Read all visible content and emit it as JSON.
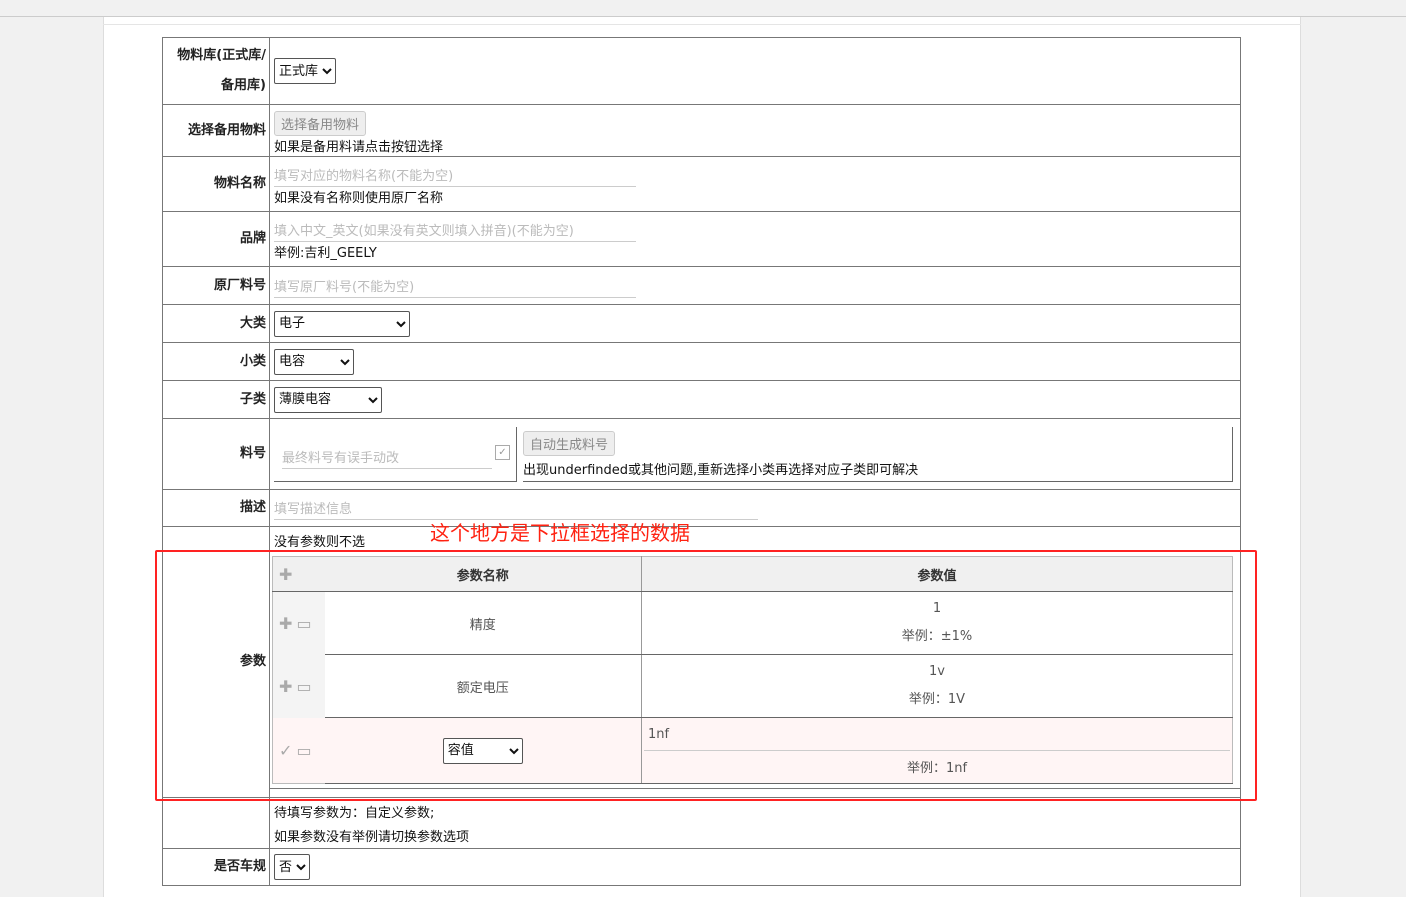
{
  "library": {
    "label": "物料库(正式库/备用库)",
    "label_line1": "物料库(正式库/",
    "label_line2": "备用库)",
    "value": "正式库"
  },
  "spare": {
    "label": "选择备用物料",
    "button": "选择备用物料",
    "note": "如果是备用料请点击按钮选择"
  },
  "name": {
    "label": "物料名称",
    "placeholder": "填写对应的物料名称(不能为空)",
    "note": "如果没有名称则使用原厂名称"
  },
  "brand": {
    "label": "品牌",
    "placeholder": "填入中文_英文(如果没有英文则填入拼音)(不能为空)",
    "note": "举例:吉利_GEELY"
  },
  "oem": {
    "label": "原厂料号",
    "placeholder": "填写原厂料号(不能为空)"
  },
  "category": {
    "label": "大类",
    "value": "电子"
  },
  "subcategory": {
    "label": "小类",
    "value": "电容"
  },
  "childcategory": {
    "label": "子类",
    "value": "薄膜电容"
  },
  "partno": {
    "label": "料号",
    "placeholder": "最终料号有误手动改",
    "button": "自动生成料号",
    "note": "出现underfinded或其他问题,重新选择小类再选择对应子类即可解决"
  },
  "desc": {
    "label": "描述",
    "placeholder": "填写描述信息"
  },
  "params": {
    "label": "参数",
    "note": "没有参数则不选",
    "header_name": "参数名称",
    "header_value": "参数值",
    "rows": [
      {
        "name": "精度",
        "value": "1",
        "example": "举例：±1%"
      },
      {
        "name": "额定电压",
        "value": "1v",
        "example": "举例：1V"
      }
    ],
    "edit_row": {
      "select": "容值",
      "value": "1nf",
      "example": "举例：1nf"
    },
    "footer1": "待填写参数为：自定义参数;",
    "footer2": "如果参数没有举例请切换参数选项"
  },
  "vehicle": {
    "label": "是否车规",
    "value": "否"
  },
  "annotation": "这个地方是下拉框选择的数据"
}
